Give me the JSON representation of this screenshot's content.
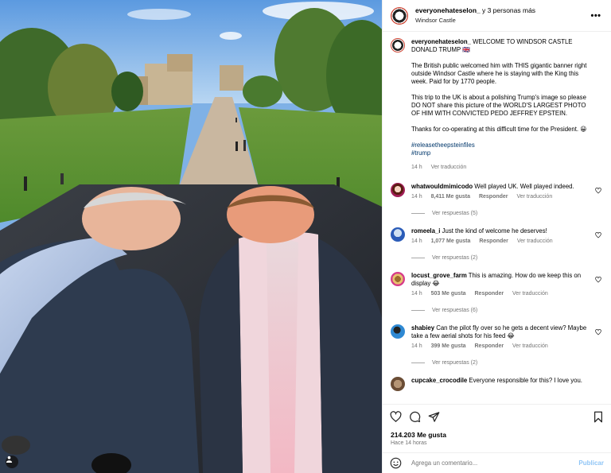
{
  "header": {
    "username": "everyonehateselon_",
    "and_more": "y 3 personas más",
    "location": "Windsor Castle"
  },
  "caption": {
    "username": "everyonehateselon_",
    "title": "WELCOME TO WINDSOR CASTLE DONALD TRUMP 🇬🇧",
    "p1": "The British public welcomed him with THIS gigantic banner right outside Windsor Castle where he is staying with the King this week. Paid for by 1770 people.",
    "p2": "This trip to the UK is about a polishing Trump's image so please DO NOT share this picture of the WORLD'S LARGEST PHOTO OF HIM WITH CONVICTED PEDO JEFFREY EPSTEIN.",
    "p3": "Thanks for co-operating at this difficult time for the President. 😀",
    "hashtag1": "#releasetheepsteinfiles",
    "hashtag2": "#trump",
    "time": "14 h",
    "translate": "Ver traducción"
  },
  "comments": [
    {
      "user": "whatwouldmimicodo",
      "text": "Well played UK. Well played indeed.",
      "time": "14 h",
      "likes": "8,411 Me gusta",
      "reply": "Responder",
      "translate": "Ver traducción",
      "replies": "Ver respuestas (5)"
    },
    {
      "user": "romeela_i",
      "text": "Just the kind of welcome he deserves!",
      "time": "14 h",
      "likes": "1,077 Me gusta",
      "reply": "Responder",
      "translate": "Ver traducción",
      "replies": "Ver respuestas (2)"
    },
    {
      "user": "locust_grove_farm",
      "text": "This is amazing. How do we keep this on display 😂",
      "time": "14 h",
      "likes": "503 Me gusta",
      "reply": "Responder",
      "translate": "Ver traducción",
      "replies": "Ver respuestas (6)"
    },
    {
      "user": "shabiey",
      "text": "Can the pilot fly over so he gets a decent view? Maybe take a few aerial shots for his feed 😂",
      "time": "14 h",
      "likes": "399 Me gusta",
      "reply": "Responder",
      "translate": "Ver traducción",
      "replies": "Ver respuestas (2)"
    },
    {
      "user": "cupcake_crocodile",
      "text": "Everyone responsible for this? I love you."
    }
  ],
  "footer": {
    "likes": "214.203 Me gusta",
    "time_ago": "Hace 14 horas",
    "comment_placeholder": "Agrega un comentario...",
    "publish": "Publicar"
  },
  "icons": [
    "heart-icon",
    "comment-icon",
    "share-icon",
    "bookmark-icon",
    "emoji-icon",
    "more-options-icon",
    "tag-user-icon"
  ],
  "colors": {
    "link": "#00376b",
    "publish": "#8fc5f6",
    "muted": "#737373"
  }
}
